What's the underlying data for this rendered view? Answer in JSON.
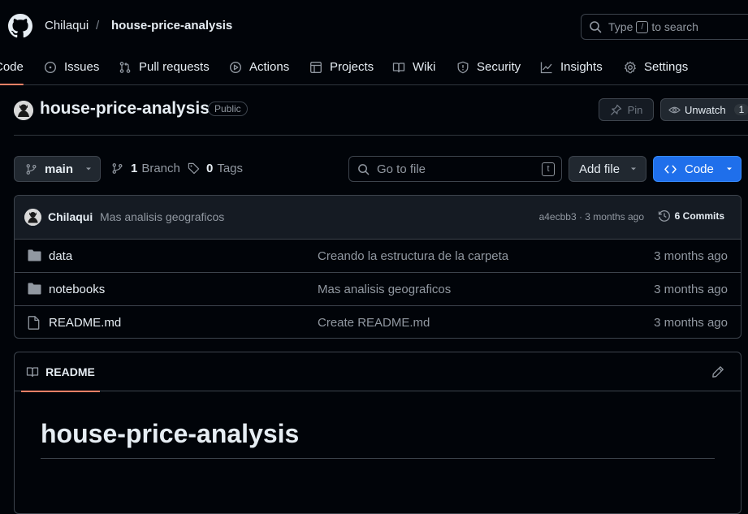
{
  "header": {
    "owner": "Chilaqui",
    "separator": "/",
    "repo": "house-price-analysis",
    "search": {
      "prefix": "Type",
      "key": "/",
      "suffix": "to search"
    }
  },
  "tabs": [
    {
      "label": "Code",
      "icon": "code-icon",
      "active": true
    },
    {
      "label": "Issues",
      "icon": "issue-icon"
    },
    {
      "label": "Pull requests",
      "icon": "pull-request-icon"
    },
    {
      "label": "Actions",
      "icon": "play-icon"
    },
    {
      "label": "Projects",
      "icon": "table-icon"
    },
    {
      "label": "Wiki",
      "icon": "book-icon"
    },
    {
      "label": "Security",
      "icon": "shield-icon"
    },
    {
      "label": "Insights",
      "icon": "graph-icon"
    },
    {
      "label": "Settings",
      "icon": "gear-icon"
    }
  ],
  "repo": {
    "title": "house-price-analysis",
    "visibility": "Public",
    "pin_label": "Pin",
    "watch_label": "Unwatch",
    "watch_count": "1"
  },
  "toolbar": {
    "branch": "main",
    "branch_count": "1",
    "branch_label": "Branch",
    "tag_count": "0",
    "tag_label": "Tags",
    "go_to_file_placeholder": "Go to file",
    "go_to_file_key": "t",
    "add_file_label": "Add file",
    "code_label": "Code"
  },
  "commit": {
    "author": "Chilaqui",
    "message": "Mas analisis geograficos",
    "meta": "a4ecbb3 · 3 months ago",
    "commits_label": "6 Commits"
  },
  "files": [
    {
      "name": "data",
      "type": "folder",
      "message": "Creando la estructura de la carpeta",
      "date": "3 months ago"
    },
    {
      "name": "notebooks",
      "type": "folder",
      "message": "Mas analisis geograficos",
      "date": "3 months ago"
    },
    {
      "name": "README.md",
      "type": "file",
      "message": "Create README.md",
      "date": "3 months ago"
    }
  ],
  "readme": {
    "tab_label": "README",
    "heading": "house-price-analysis"
  },
  "colors": {
    "background": "#010409",
    "accent_underline": "#f78166",
    "primary_button": "#1f6feb"
  }
}
